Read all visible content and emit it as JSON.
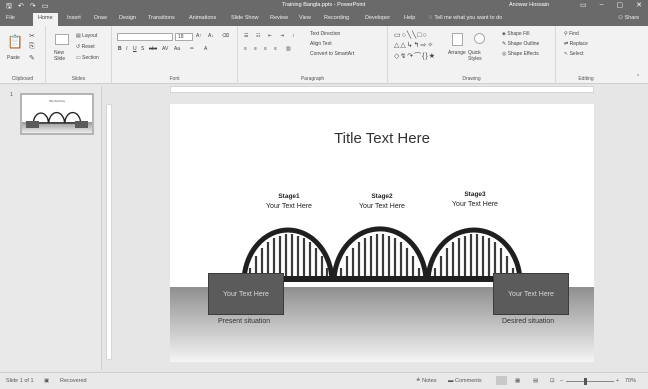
{
  "window": {
    "title": "Training Bangla.pptx - PowerPoint",
    "user": "Anowar Hossain",
    "qat_icons": [
      "save-icon",
      "undo-icon",
      "redo-icon",
      "present-icon"
    ]
  },
  "tabs": [
    {
      "label": "File"
    },
    {
      "label": "Home",
      "active": true
    },
    {
      "label": "Insert"
    },
    {
      "label": "Draw"
    },
    {
      "label": "Design"
    },
    {
      "label": "Transitions"
    },
    {
      "label": "Animations"
    },
    {
      "label": "Slide Show"
    },
    {
      "label": "Review"
    },
    {
      "label": "View"
    },
    {
      "label": "Recording"
    },
    {
      "label": "Developer"
    },
    {
      "label": "Help"
    }
  ],
  "tell_me": "Tell me what you want to do",
  "share_label": "Share",
  "ribbon": {
    "clipboard": {
      "paste": "Paste",
      "label": "Clipboard"
    },
    "slides": {
      "new_slide": "New Slide",
      "layout": "Layout",
      "reset": "Reset",
      "section": "Section",
      "label": "Slides"
    },
    "font": {
      "size": "18",
      "label": "Font"
    },
    "paragraph": {
      "text_direction": "Text Direction",
      "align_text": "Align Text",
      "smartart": "Convert to SmartArt",
      "label": "Paragraph"
    },
    "drawing": {
      "arrange": "Arrange",
      "quick_styles": "Quick Styles",
      "shape_fill": "Shape Fill",
      "shape_outline": "Shape Outline",
      "shape_effects": "Shape Effects",
      "label": "Drawing"
    },
    "editing": {
      "find": "Find",
      "replace": "Replace",
      "select": "Select",
      "label": "Editing"
    }
  },
  "thumbnails": [
    {
      "number": "1",
      "title": "Title Text Here"
    }
  ],
  "slide": {
    "title": "Title Text Here",
    "stages": [
      {
        "name": "Stage1",
        "text": "Your Text Here"
      },
      {
        "name": "Stage2",
        "text": "Your Text Here"
      },
      {
        "name": "Stage3",
        "text": "Your Text Here"
      }
    ],
    "left_box": "Your Text Here",
    "right_box": "Your Text Here",
    "left_caption": "Present situation",
    "right_caption": "Desired situation",
    "colors": {
      "bridge": "#1f1f1f",
      "box": "#5b5b5b",
      "ground": "#8f8f8f"
    }
  },
  "status": {
    "slide_info": "Slide 1 of 1",
    "recovered": "Recovered",
    "notes": "Notes",
    "comments": "Comments",
    "zoom": "70%"
  }
}
